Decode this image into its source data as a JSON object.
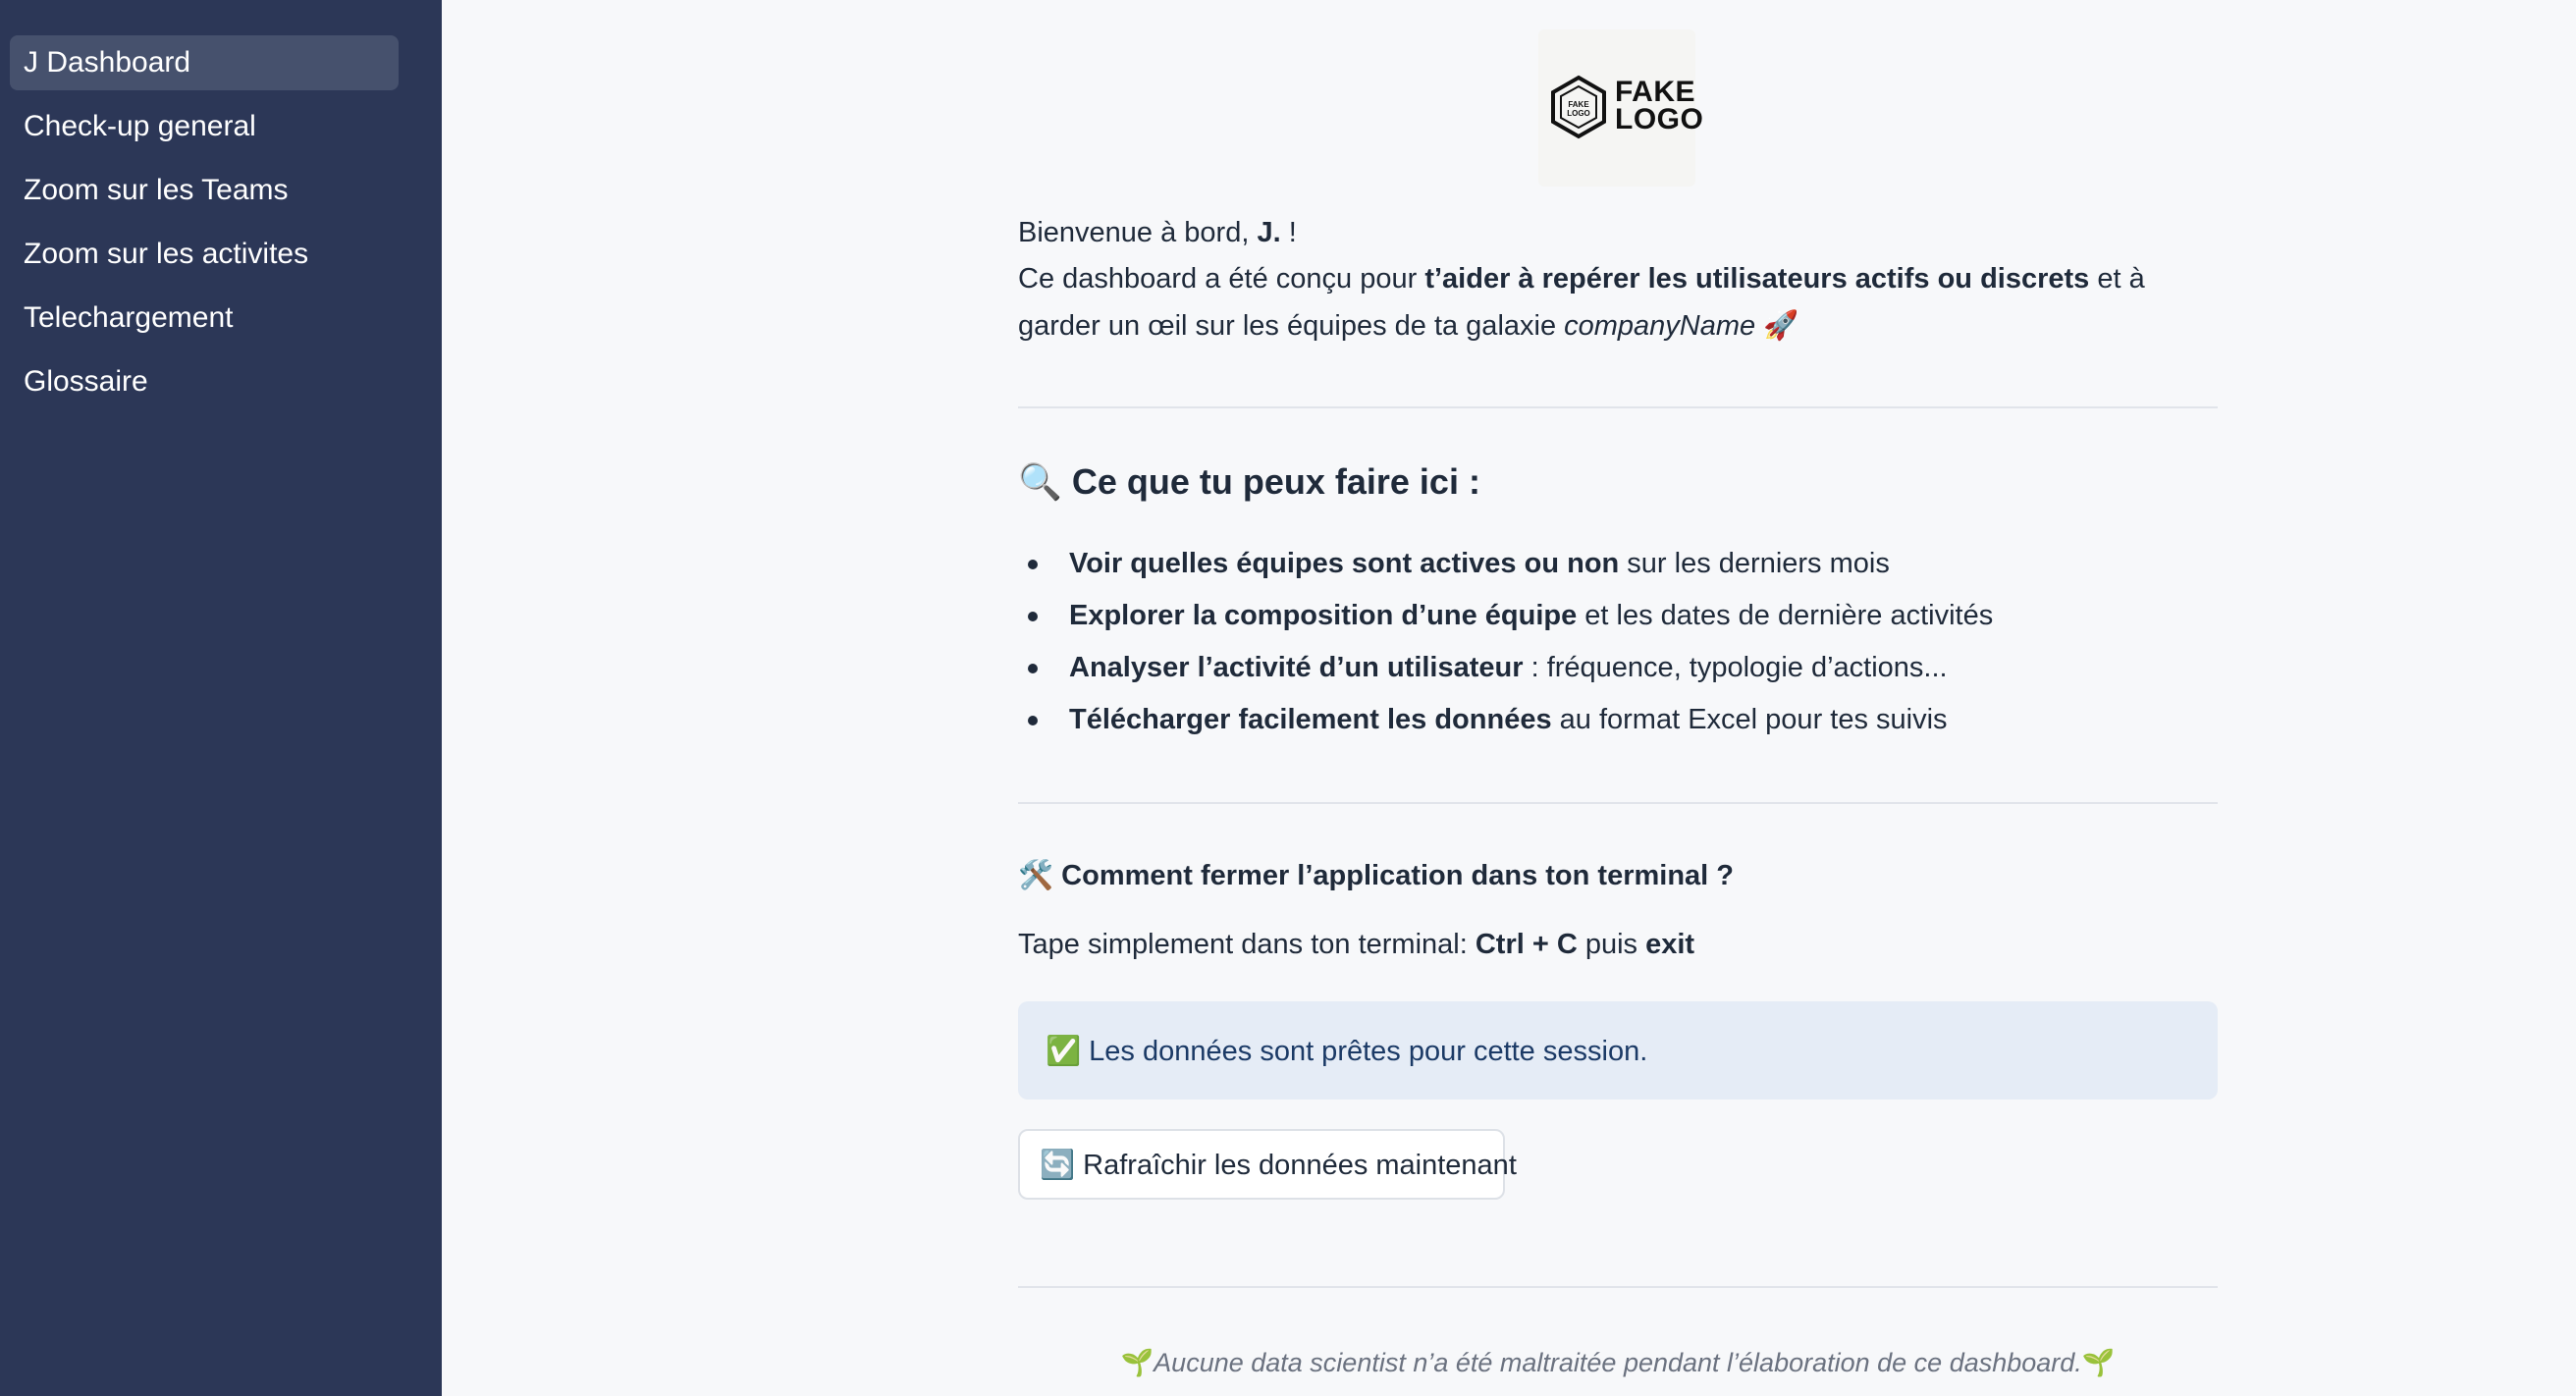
{
  "sidebar": {
    "items": [
      {
        "label": "J Dashboard",
        "active": true
      },
      {
        "label": "Check-up general"
      },
      {
        "label": "Zoom sur les Teams"
      },
      {
        "label": "Zoom sur les activites"
      },
      {
        "label": "Telechargement"
      },
      {
        "label": "Glossaire"
      }
    ]
  },
  "logo": {
    "line1": "FAKE",
    "line2": "LOGO",
    "badge_line1": "FAKE",
    "badge_line2": "LOGO"
  },
  "welcome": {
    "line1_prefix": "Bienvenue à bord, ",
    "user": "J.",
    "line1_suffix": " !",
    "line2_prefix": "Ce dashboard a été conçu pour ",
    "line2_bold": "t’aider à repérer les utilisateurs actifs ou discrets",
    "line2_suffix": " et à garder un œil sur les équipes de ta galaxie ",
    "company": "companyName",
    "rocket": "🚀"
  },
  "features": {
    "title_icon": "🔍",
    "title": "Ce que tu peux faire ici :",
    "items": [
      {
        "bold": "Voir quelles équipes sont actives ou non",
        "text": " sur les derniers mois"
      },
      {
        "bold": "Explorer la composition d’une équipe",
        "text": " et les dates de dernière activités"
      },
      {
        "bold": "Analyser l’activité d’un utilisateur",
        "text": " : fréquence, typologie d’actions..."
      },
      {
        "bold": "Télécharger facilement les données",
        "text": " au format Excel pour tes suivis"
      }
    ]
  },
  "howto": {
    "icon": "🛠️",
    "title": "Comment fermer l’application dans ton terminal ?",
    "text_prefix": "Tape simplement dans ton terminal: ",
    "shortcut": "Ctrl + C",
    "middle": " puis ",
    "command": "exit"
  },
  "status": {
    "icon": "✅",
    "message": "Les données sont prêtes pour cette session."
  },
  "refresh": {
    "icon": "🔄",
    "label": "Rafraîchir les données maintenant"
  },
  "footer": {
    "icon": "🌱",
    "text": "Aucune data scientist n’a été maltraitée pendant l’élaboration de ce dashboard."
  },
  "colors": {
    "sidebar_bg": "#2c3757",
    "sidebar_active": "#46516d",
    "page_bg": "#f7f8fa",
    "info_bg": "#e5ecf6",
    "info_text": "#1b3a66"
  }
}
